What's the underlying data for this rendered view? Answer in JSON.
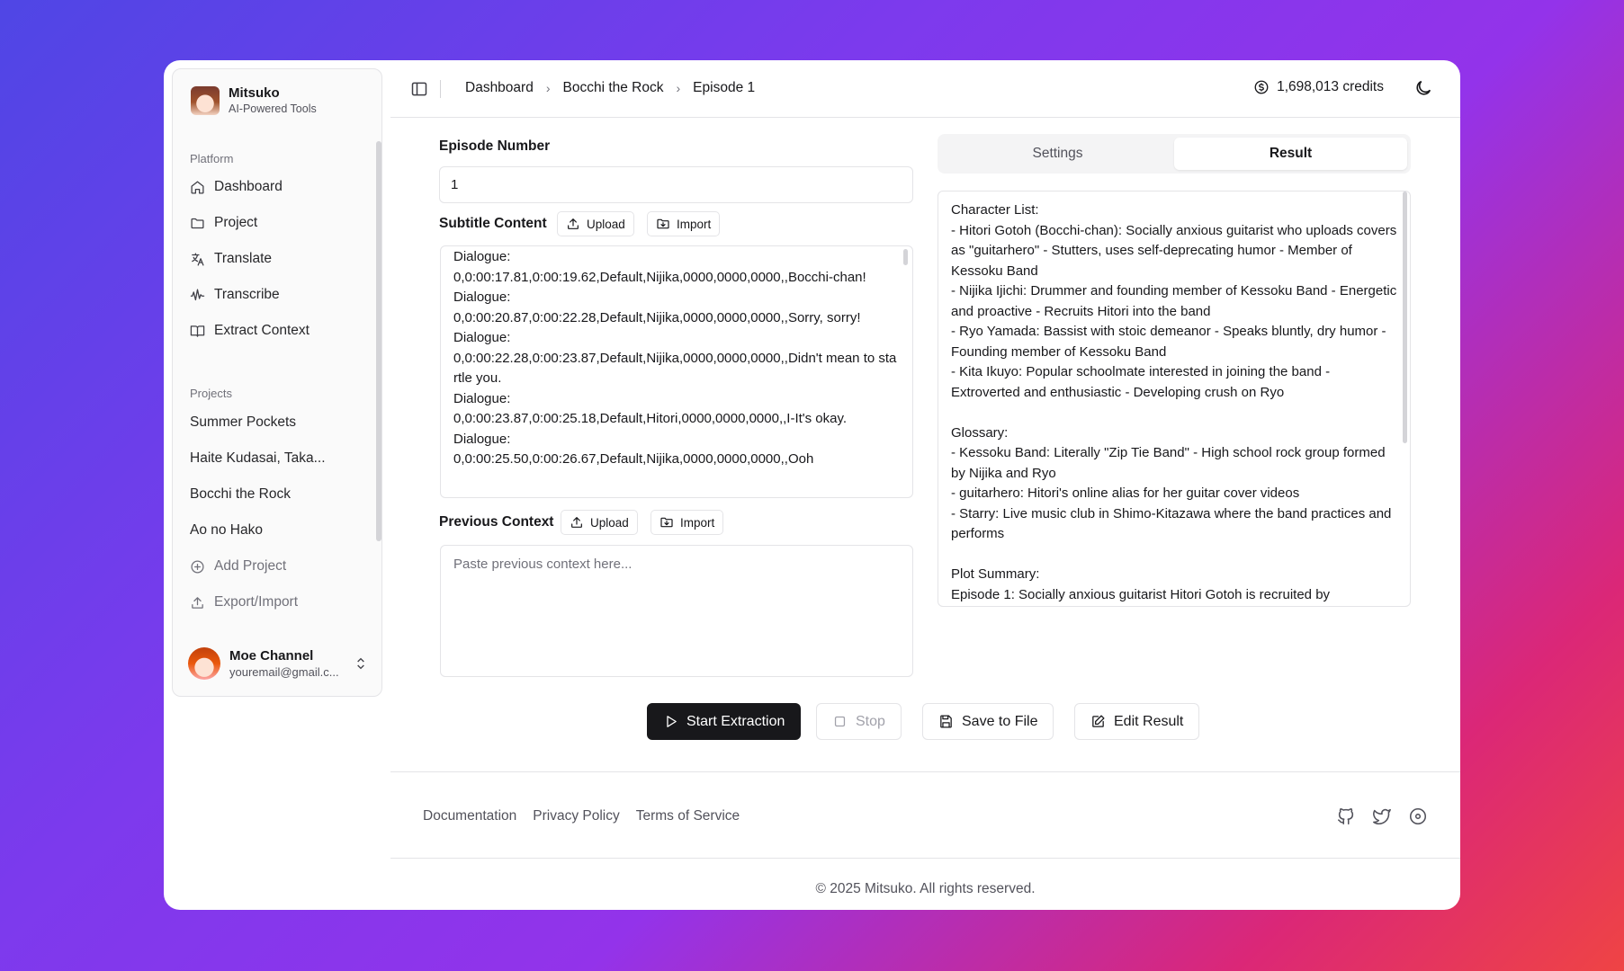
{
  "brand": {
    "name": "Mitsuko",
    "tagline": "AI-Powered Tools"
  },
  "sidebar": {
    "platform_label": "Platform",
    "platform_items": [
      {
        "label": "Dashboard",
        "icon": "home-icon"
      },
      {
        "label": "Project",
        "icon": "folder-icon"
      },
      {
        "label": "Translate",
        "icon": "languages-icon"
      },
      {
        "label": "Transcribe",
        "icon": "audio-waveform-icon"
      },
      {
        "label": "Extract Context",
        "icon": "book-open-icon"
      }
    ],
    "projects_label": "Projects",
    "project_items": [
      "Summer Pockets",
      "Haite Kudasai, Taka...",
      "Bocchi the Rock",
      "Ao no Hako"
    ],
    "add_project": "Add Project",
    "export_import": "Export/Import",
    "user": {
      "name": "Moe Channel",
      "email": "youremail@gmail.c..."
    }
  },
  "header": {
    "breadcrumbs": [
      "Dashboard",
      "Bocchi the Rock",
      "Episode 1"
    ],
    "credits": "1,698,013 credits"
  },
  "form": {
    "episode_label": "Episode Number",
    "episode_value": "1",
    "subtitle_label": "Subtitle Content",
    "upload_label": "Upload",
    "import_label": "Import",
    "subtitle_text": "Dialogue:\n0,0:00:17.81,0:00:19.62,Default,Nijika,0000,0000,0000,,Bocchi-chan!\nDialogue:\n0,0:00:20.87,0:00:22.28,Default,Nijika,0000,0000,0000,,Sorry, sorry!\nDialogue:\n0,0:00:22.28,0:00:23.87,Default,Nijika,0000,0000,0000,,Didn't mean to startle you.\nDialogue:\n0,0:00:23.87,0:00:25.18,Default,Hitori,0000,0000,0000,,I-It's okay.\nDialogue:\n0,0:00:25.50,0:00:26.67,Default,Nijika,0000,0000,0000,,Ooh",
    "previous_label": "Previous Context",
    "previous_placeholder": "Paste previous context here..."
  },
  "tabs": [
    "Settings",
    "Result"
  ],
  "active_tab": "Result",
  "result_text": "Character List:\n- Hitori Gotoh (Bocchi-chan): Socially anxious guitarist who uploads covers as \"guitarhero\" - Stutters, uses self-deprecating humor - Member of Kessoku Band\n- Nijika Ijichi: Drummer and founding member of Kessoku Band - Energetic and proactive - Recruits Hitori into the band\n- Ryo Yamada: Bassist with stoic demeanor - Speaks bluntly, dry humor - Founding member of Kessoku Band\n- Kita Ikuyo: Popular schoolmate interested in joining the band - Extroverted and enthusiastic - Developing crush on Ryo\n\nGlossary:\n- Kessoku Band: Literally \"Zip Tie Band\" - High school rock group formed by Nijika and Ryo\n- guitarhero: Hitori's online alias for her guitar cover videos\n- Starry: Live music club in Shimo-Kitazawa where the band practices and performs\n\nPlot Summary:\nEpisode 1: Socially anxious guitarist Hitori Gotoh is recruited by",
  "actions": {
    "start": "Start Extraction",
    "stop": "Stop",
    "save": "Save to File",
    "edit": "Edit Result"
  },
  "footer": {
    "links": [
      "Documentation",
      "Privacy Policy",
      "Terms of Service"
    ],
    "icons": [
      "github-icon",
      "twitter-icon",
      "discord-icon"
    ],
    "copyright": "© 2025 Mitsuko. All rights reserved."
  }
}
